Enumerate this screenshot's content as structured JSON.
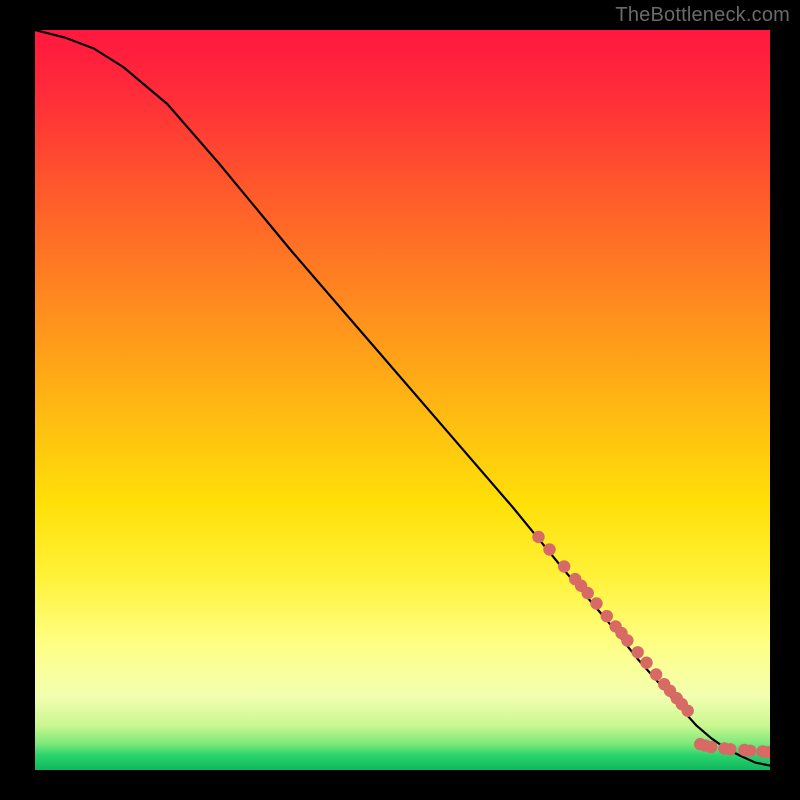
{
  "watermark": "TheBottleneck.com",
  "chart_data": {
    "type": "line",
    "title": "",
    "xlabel": "",
    "ylabel": "",
    "xlim": [
      0,
      100
    ],
    "ylim": [
      0,
      100
    ],
    "grid": false,
    "legend": false,
    "series": [
      {
        "name": "curve",
        "type": "line",
        "x": [
          0,
          4,
          8,
          12,
          18,
          25,
          35,
          45,
          55,
          65,
          72,
          78,
          82,
          86,
          88,
          90,
          92,
          94,
          96,
          98,
          100
        ],
        "y": [
          100,
          99,
          97.5,
          95,
          90,
          82,
          70,
          58.5,
          47,
          35.5,
          27,
          20,
          15,
          10.5,
          8.2,
          6,
          4.3,
          2.9,
          1.9,
          1.0,
          0.6
        ]
      },
      {
        "name": "markers",
        "type": "scatter",
        "x": [
          68.5,
          70.0,
          72.0,
          73.5,
          74.3,
          75.2,
          76.4,
          77.8,
          79.0,
          79.8,
          80.6,
          82.0,
          83.2,
          84.5,
          85.6,
          86.4,
          87.3,
          88.0,
          88.8,
          90.5,
          91.2,
          92.0,
          93.8,
          94.6,
          96.5,
          97.3,
          99.0,
          99.8
        ],
        "y": [
          31.5,
          29.8,
          27.5,
          25.8,
          24.9,
          23.9,
          22.5,
          20.8,
          19.4,
          18.5,
          17.5,
          15.9,
          14.5,
          12.9,
          11.6,
          10.7,
          9.7,
          8.9,
          8.0,
          3.5,
          3.3,
          3.1,
          2.9,
          2.8,
          2.7,
          2.6,
          2.5,
          2.4
        ]
      }
    ],
    "colors": {
      "gradient_top": "#ff1a3c",
      "gradient_mid": "#ffd000",
      "gradient_low": "#ffff66",
      "gradient_bottom": "#17d86b",
      "curve": "#000000",
      "marker": "#d86a66",
      "background": "#000000"
    }
  }
}
